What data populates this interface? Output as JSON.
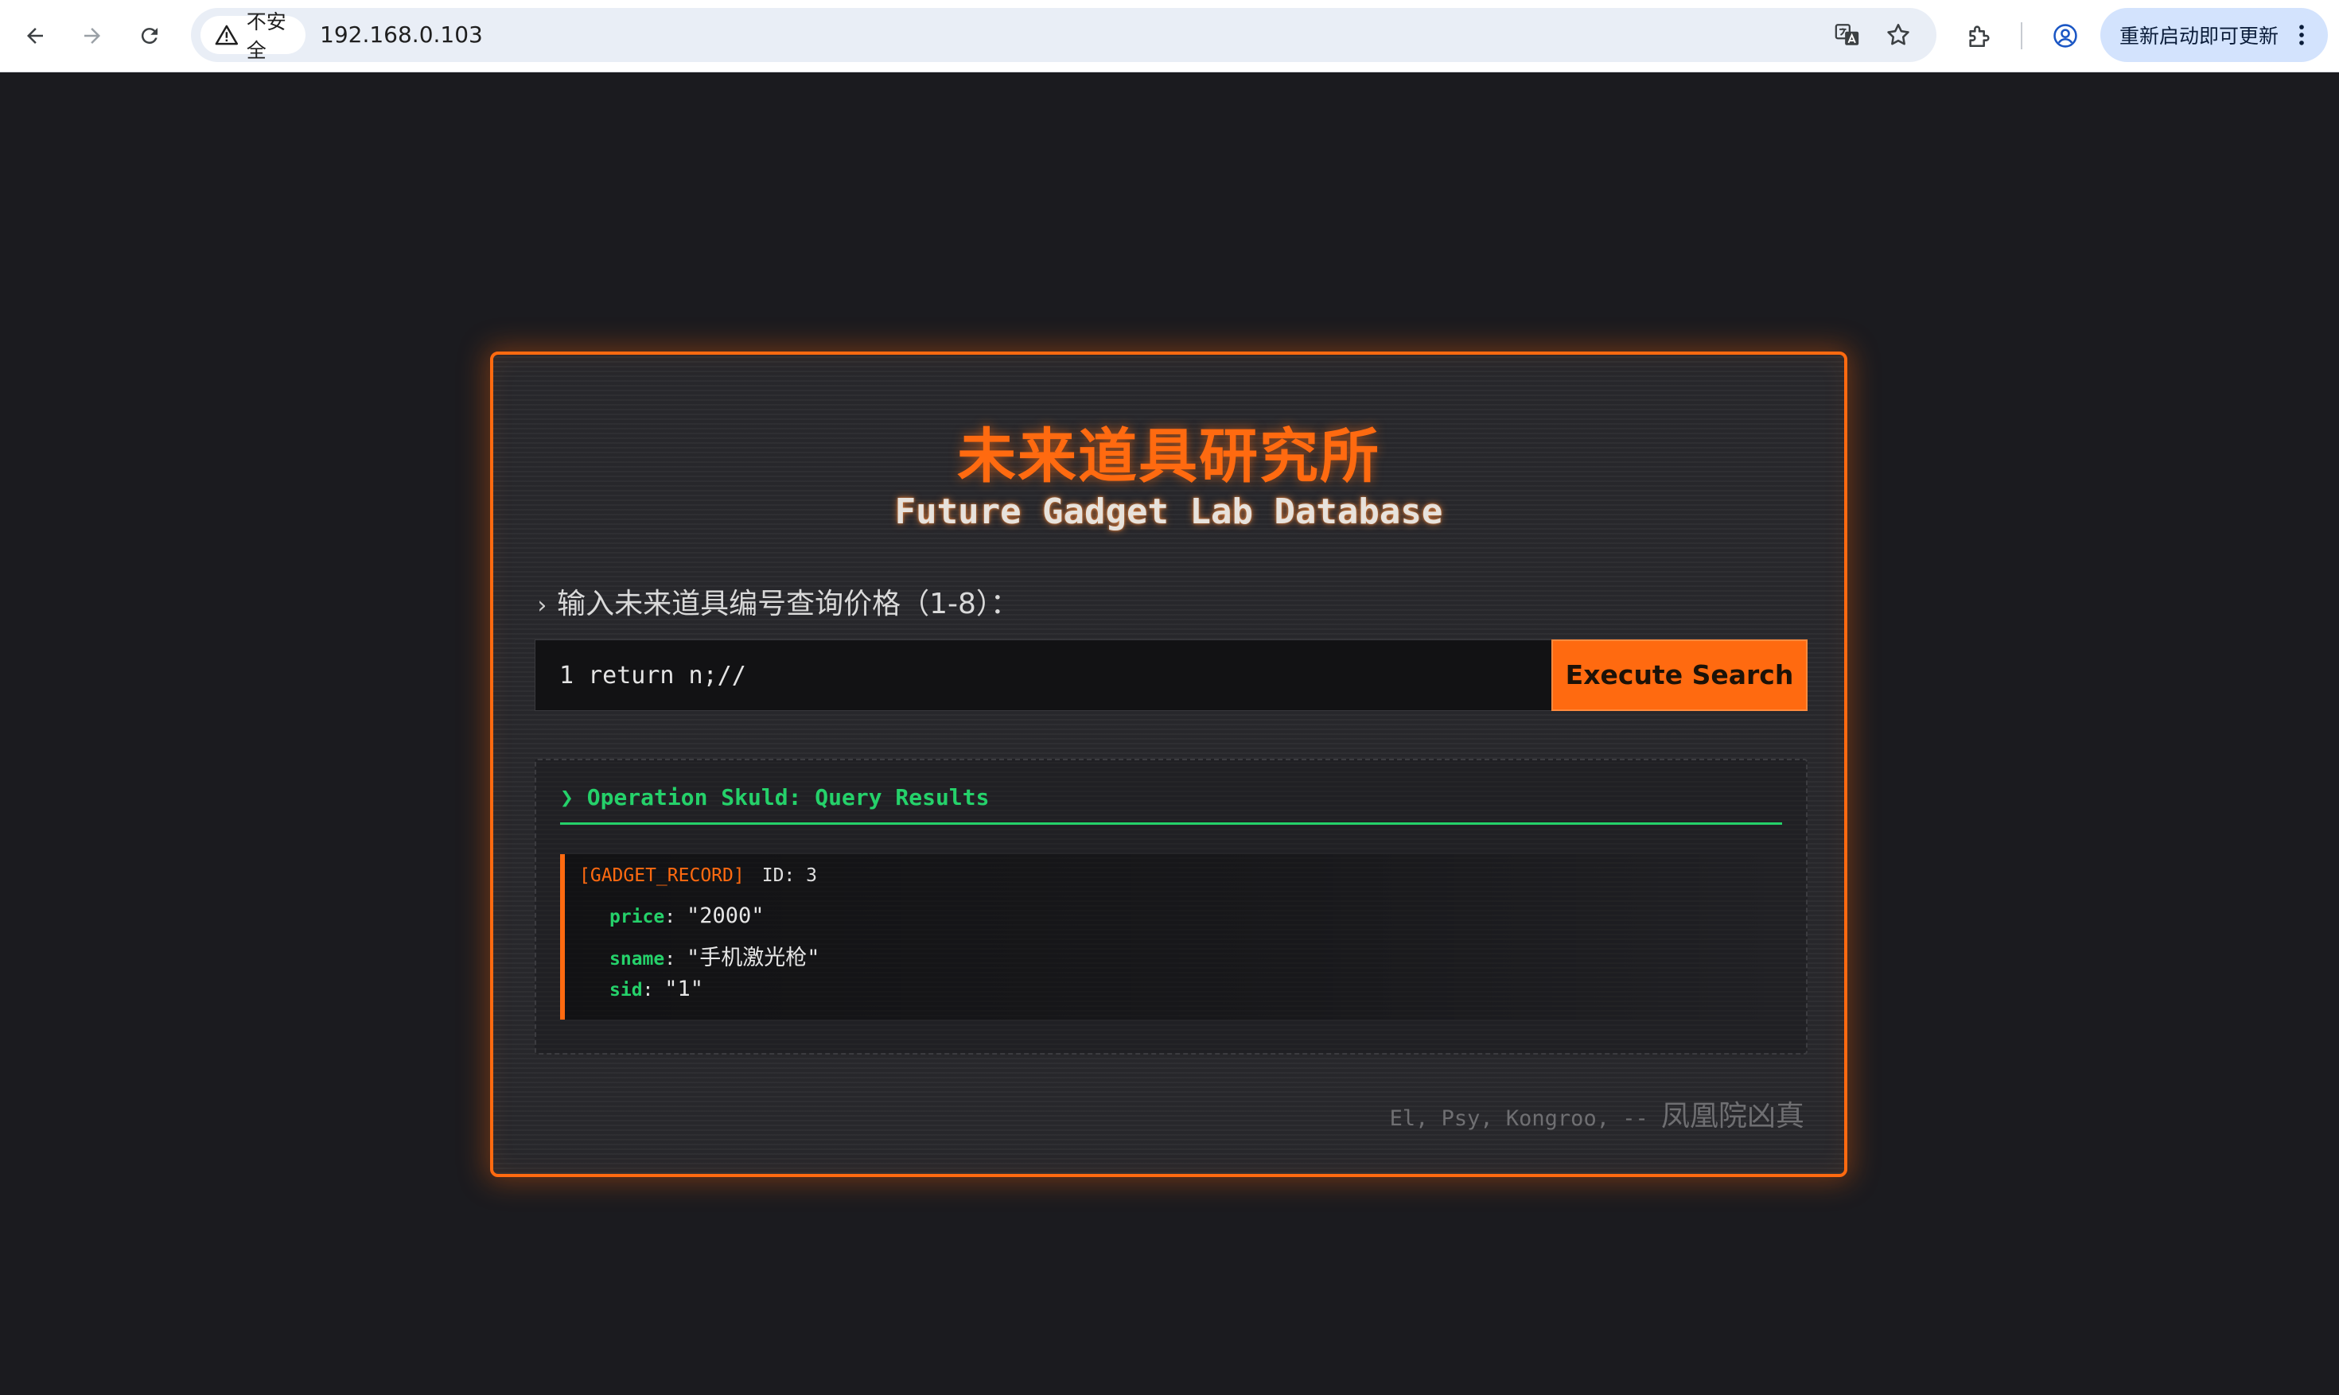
{
  "browser": {
    "security_label": "不安全",
    "url": "192.168.0.103",
    "update_label": "重新启动即可更新"
  },
  "page": {
    "title_cn": "未来道具研究所",
    "title_en": "Future Gadget Lab Database",
    "prompt": "输入未来道具编号查询价格（1-8）：",
    "prompt_chevron": "›",
    "search": {
      "value": "1 return n;//",
      "placeholder": ""
    },
    "execute_label": "Execute Search",
    "results": {
      "title": "❯ Operation Skuld: Query Results",
      "record": {
        "tag": "[GADGET_RECORD]",
        "id_label": "ID: 3",
        "fields": [
          {
            "key": "price",
            "value": "\"2000\""
          },
          {
            "key": "sname",
            "value": "\"手机激光枪\""
          },
          {
            "key": "sid",
            "value": "\"1\""
          }
        ]
      }
    },
    "footer": {
      "quote": "El, Psy, Kongroo, -- ",
      "signature": "凤凰院凶真"
    }
  },
  "colors": {
    "accent": "#ff6a10",
    "success": "#25d16a",
    "background": "#1b1b1f",
    "panel": "#27272b"
  },
  "icons": [
    "back-arrow-icon",
    "forward-arrow-icon",
    "reload-icon",
    "warning-icon",
    "translate-icon",
    "star-icon",
    "extensions-icon",
    "profile-icon",
    "more-vert-icon"
  ]
}
